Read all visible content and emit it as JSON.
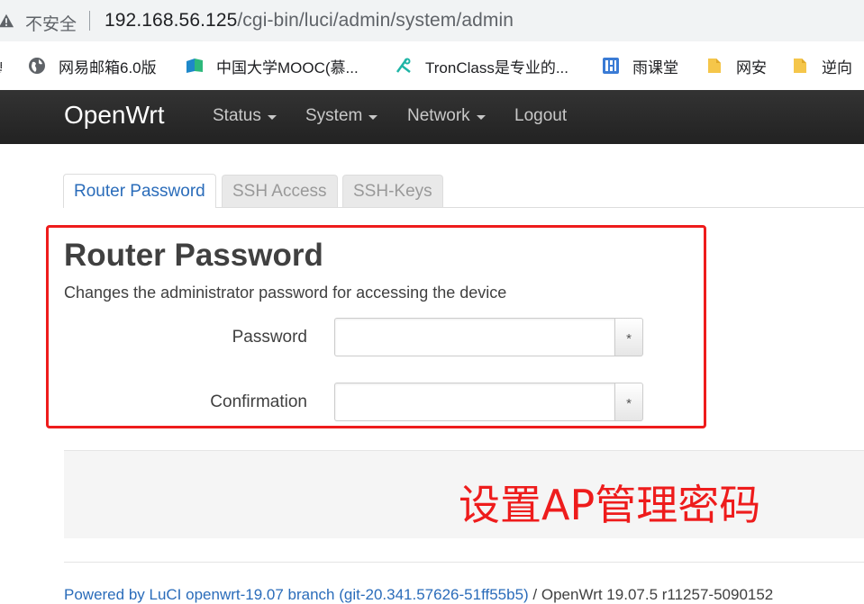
{
  "browser": {
    "security_label": "不安全",
    "url_host": "192.168.56.125",
    "url_path": "/cgi-bin/luci/admin/system/admin"
  },
  "bookmarks": [
    {
      "label": "网易邮箱6.0版",
      "icon": "globe-icon"
    },
    {
      "label": "中国大学MOOC(慕...",
      "icon": "mooc-icon"
    },
    {
      "label": "TronClass是专业的...",
      "icon": "tronclass-icon"
    },
    {
      "label": "雨课堂",
      "icon": "rainclassroom-icon"
    },
    {
      "label": "网安",
      "icon": "folder-icon"
    },
    {
      "label": "逆向",
      "icon": "folder-icon"
    }
  ],
  "navbar": {
    "brand": "OpenWrt",
    "items": [
      {
        "label": "Status"
      },
      {
        "label": "System"
      },
      {
        "label": "Network"
      },
      {
        "label": "Logout"
      }
    ]
  },
  "tabs": [
    {
      "label": "Router Password",
      "active": true
    },
    {
      "label": "SSH Access",
      "active": false
    },
    {
      "label": "SSH-Keys",
      "active": false
    }
  ],
  "section": {
    "title": "Router Password",
    "description": "Changes the administrator password for accessing the device",
    "fields": [
      {
        "label": "Password",
        "value": "",
        "reveal": "*"
      },
      {
        "label": "Confirmation",
        "value": "",
        "reveal": "*"
      }
    ]
  },
  "annotation": "设置AP管理密码",
  "footer": {
    "link": "Powered by LuCI openwrt-19.07 branch (git-20.341.57626-51ff55b5)",
    "separator": " / ",
    "version": "OpenWrt 19.07.5 r11257-5090152"
  },
  "colors": {
    "accent": "#2a6cba",
    "annotation_red": "#ee1c1c",
    "navbar": "#222222"
  }
}
